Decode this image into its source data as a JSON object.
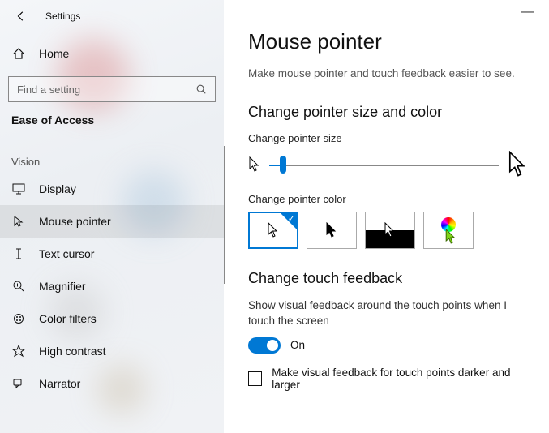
{
  "window": {
    "title": "Settings"
  },
  "sidebar": {
    "home": "Home",
    "search_placeholder": "Find a setting",
    "category": "Ease of Access",
    "group": "Vision",
    "items": [
      {
        "label": "Display"
      },
      {
        "label": "Mouse pointer"
      },
      {
        "label": "Text cursor"
      },
      {
        "label": "Magnifier"
      },
      {
        "label": "Color filters"
      },
      {
        "label": "High contrast"
      },
      {
        "label": "Narrator"
      }
    ]
  },
  "main": {
    "title": "Mouse pointer",
    "subtitle": "Make mouse pointer and touch feedback easier to see.",
    "section_size_color": "Change pointer size and color",
    "size_label": "Change pointer size",
    "color_label": "Change pointer color",
    "section_touch": "Change touch feedback",
    "touch_desc": "Show visual feedback around the touch points when I touch the screen",
    "toggle_state": "On",
    "checkbox_label": "Make visual feedback for touch points darker and larger"
  }
}
